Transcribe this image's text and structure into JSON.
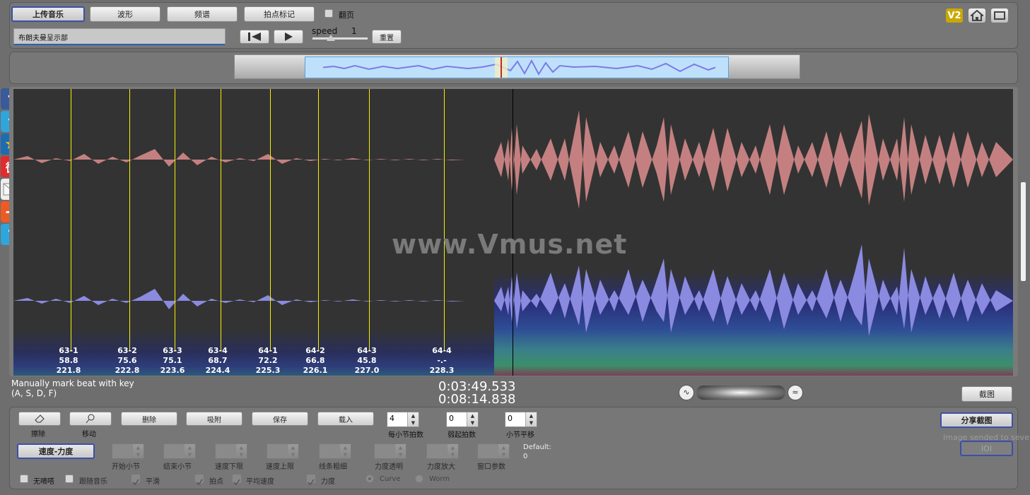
{
  "toolbar": {
    "upload": "上传音乐",
    "waveform": "波形",
    "spectrum": "频谱",
    "beat_mark": "拍点标记",
    "flip_page": "翻页",
    "song_name": "布朗夫曼呈示部",
    "speed_label": "speed",
    "speed_value": "1",
    "reset": "重置",
    "v2": "V2"
  },
  "watermark": "www.Vmus.net",
  "beats": [
    {
      "bar": "63-1",
      "tempo": "58.8",
      "time": "221.8"
    },
    {
      "bar": "63-2",
      "tempo": "75.6",
      "time": "222.8"
    },
    {
      "bar": "63-3",
      "tempo": "75.1",
      "time": "223.6"
    },
    {
      "bar": "63-4",
      "tempo": "68.7",
      "time": "224.4"
    },
    {
      "bar": "64-1",
      "tempo": "72.2",
      "time": "225.3"
    },
    {
      "bar": "64-2",
      "tempo": "66.8",
      "time": "226.1"
    },
    {
      "bar": "64-3",
      "tempo": "45.8",
      "time": "227.0"
    },
    {
      "bar": "64-4",
      "tempo": "-.-",
      "time": "228.3"
    }
  ],
  "status": {
    "hint_line1": "Manually mark beat with key",
    "hint_line2": "(A, S, D, F)",
    "current_time": "0:03:49.533",
    "total_time": "0:08:14.838",
    "screenshot": "截图"
  },
  "edit": {
    "erase": "擦除",
    "move": "移动",
    "delete": "删除",
    "snap": "吸附",
    "save": "保存",
    "load": "载入",
    "beats_per_bar_value": "4",
    "beats_per_bar_label": "每小节拍数",
    "pickup_value": "0",
    "pickup_label": "弱起拍数",
    "bar_offset_value": "0",
    "bar_offset_label": "小节平移",
    "share": "分享截图",
    "share_msg": "Image sended to sever",
    "ioi": "IOI"
  },
  "curve": {
    "tab": "速度-力度",
    "start_bar": "开始小节",
    "end_bar": "结束小节",
    "speed_min": "速度下限",
    "speed_max": "速度上限",
    "line_width": "线条粗细",
    "dyn_alpha": "力度透明",
    "dyn_zoom": "力度放大",
    "window_param": "窗口参数",
    "default_label": "Default:",
    "default_value": "0",
    "no_metronome": "无嘀嗒",
    "follow_music": "跟随音乐",
    "smooth": "平滑",
    "beat_pt": "拍点",
    "avg_speed": "平均速度",
    "dynamics": "力度",
    "curve_opt": "Curve",
    "worm_opt": "Worm"
  },
  "colors": {
    "upper_wave": "#c48080",
    "lower_wave": "#8a8ae0",
    "beat_line": "#f7f000",
    "accent": "#3c4fa8"
  }
}
